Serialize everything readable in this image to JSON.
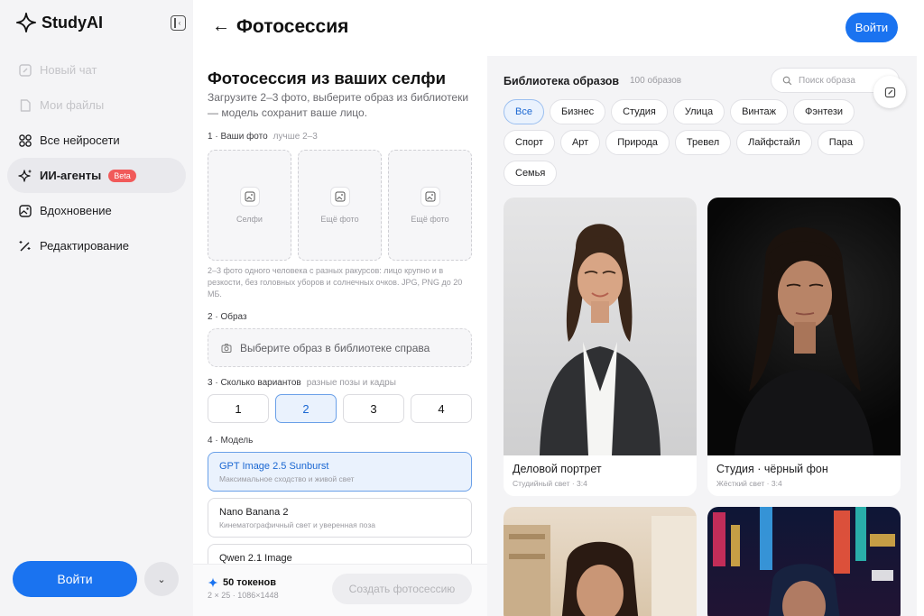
{
  "app": {
    "name": "StudyAI"
  },
  "sidebar": {
    "items": [
      {
        "label": "Новый чат",
        "state": "disabled",
        "icon": "edit-icon"
      },
      {
        "label": "Мои файлы",
        "state": "disabled",
        "icon": "file-icon"
      },
      {
        "label": "Все нейросети",
        "state": "normal",
        "icon": "grid-icon"
      },
      {
        "label": "ИИ-агенты",
        "state": "active",
        "icon": "sparkle-icon",
        "badge": "Beta"
      },
      {
        "label": "Вдохновение",
        "state": "normal",
        "icon": "image-icon"
      },
      {
        "label": "Редактирование",
        "state": "normal",
        "icon": "magic-wand-icon"
      }
    ],
    "login_label": "Войти"
  },
  "header": {
    "title": "Фотосессия",
    "login_label": "Войти"
  },
  "form": {
    "title": "Фотосессия из ваших селфи",
    "subtitle": "Загрузите 2–3 фото, выберите образ из библиотеки — модель сохранит ваше лицо.",
    "photos": {
      "label": "1 · Ваши фото",
      "hint": "лучше 2–3",
      "slots": [
        "Селфи",
        "Ещё фото",
        "Ещё фото"
      ],
      "note": "2–3 фото одного человека с разных ракурсов: лицо крупно и в резкости, без головных уборов и солнечных очков. JPG, PNG до 20 МБ."
    },
    "style": {
      "label": "2 · Образ",
      "placeholder": "Выберите образ в библиотеке справа"
    },
    "variants": {
      "label": "3 · Сколько вариантов",
      "hint": "разные позы и кадры",
      "options": [
        "1",
        "2",
        "3",
        "4"
      ],
      "selected": "2"
    },
    "model": {
      "label": "4 · Модель",
      "options": [
        {
          "name": "GPT Image 2.5 Sunburst",
          "desc": "Максимальное сходство и живой свет",
          "selected": true
        },
        {
          "name": "Nano Banana 2",
          "desc": "Кинематографичный свет и уверенная поза",
          "selected": false
        },
        {
          "name": "Qwen 2.1 Image",
          "desc": "",
          "selected": false
        }
      ]
    },
    "footer": {
      "tokens": "50 токенов",
      "tokens_detail": "2 × 25 · 1086×1448",
      "create_label": "Создать фотосессию"
    }
  },
  "library": {
    "title": "Библиотека образов",
    "count": "100 образов",
    "search_placeholder": "Поиск образа",
    "categories": [
      "Все",
      "Бизнес",
      "Студия",
      "Улица",
      "Винтаж",
      "Фэнтези",
      "Спорт",
      "Арт",
      "Природа",
      "Тревел",
      "Лайфстайл",
      "Пара",
      "Семья"
    ],
    "selected_category": "Все",
    "cards": [
      {
        "title": "Деловой портрет",
        "subtitle": "Студийный свет · 3:4"
      },
      {
        "title": "Студия · чёрный фон",
        "subtitle": "Жёсткий свет · 3:4"
      },
      {
        "title": "",
        "subtitle": ""
      },
      {
        "title": "",
        "subtitle": ""
      }
    ]
  },
  "colors": {
    "accent": "#1a73f0",
    "selected_bg": "#eaf2fd",
    "beta_badge": "#f15a5a",
    "sidebar_bg": "#f4f4f6"
  }
}
